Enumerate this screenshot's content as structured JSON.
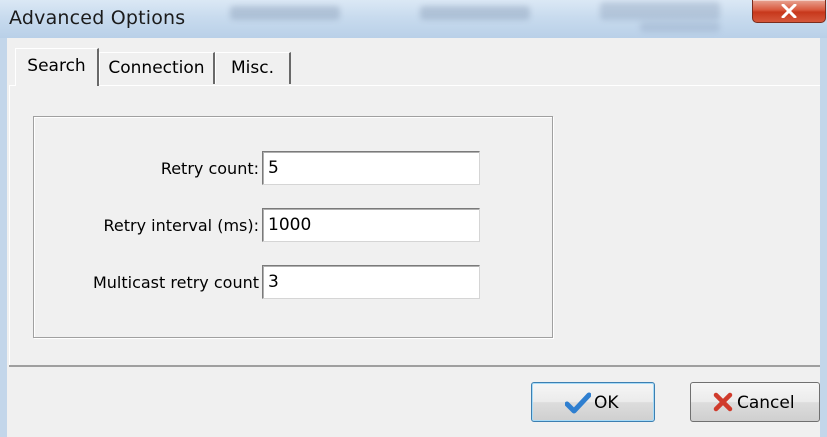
{
  "window": {
    "title": "Advanced Options"
  },
  "tabs": [
    {
      "label": "Search",
      "active": true
    },
    {
      "label": "Connection",
      "active": false
    },
    {
      "label": "Misc.",
      "active": false
    }
  ],
  "form": {
    "retry_count": {
      "label": "Retry count:",
      "value": "5"
    },
    "retry_interval": {
      "label": "Retry interval (ms):",
      "value": "1000"
    },
    "multicast_retry_count": {
      "label": "Multicast retry count",
      "value": "3"
    }
  },
  "buttons": {
    "ok": {
      "label": "OK",
      "icon": "checkmark-icon",
      "icon_color": "#2f7fd0"
    },
    "cancel": {
      "label": "Cancel",
      "icon": "red-x-icon",
      "icon_color": "#d03b2c"
    }
  },
  "colors": {
    "titlebar": "#c8dbee",
    "close_button": "#c7381c",
    "client": "#f0f0f0"
  }
}
